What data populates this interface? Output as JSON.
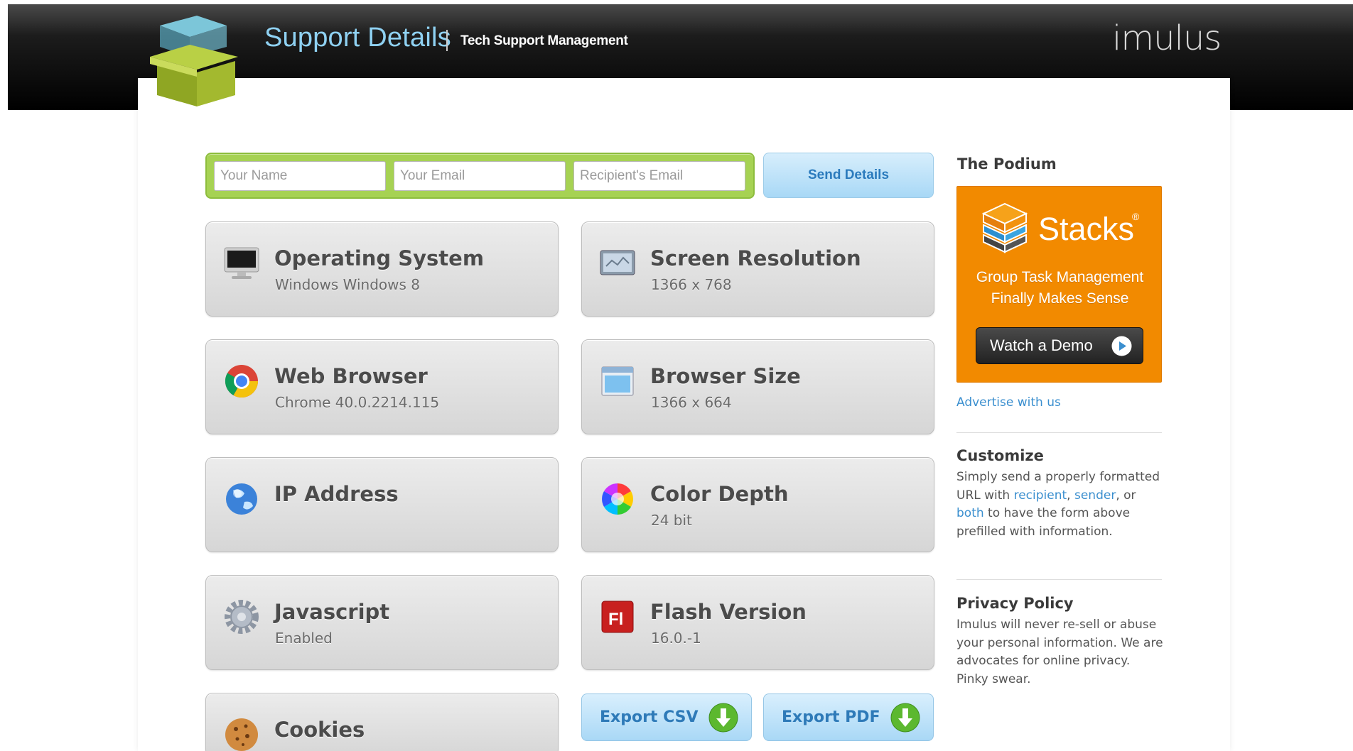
{
  "header": {
    "title": "Support Details",
    "subtitle": "Tech Support Management",
    "brand": "imulus"
  },
  "form": {
    "name_placeholder": "Your Name",
    "email_placeholder": "Your Email",
    "recipient_placeholder": "Recipient's Email",
    "send_label": "Send Details"
  },
  "tiles": {
    "os": {
      "label": "Operating System",
      "value": "Windows Windows 8"
    },
    "resolution": {
      "label": "Screen Resolution",
      "value": "1366 x 768"
    },
    "browser": {
      "label": "Web Browser",
      "value": "Chrome 40.0.2214.115"
    },
    "browser_size": {
      "label": "Browser Size",
      "value": "1366 x 664"
    },
    "ip": {
      "label": "IP Address",
      "value": ""
    },
    "color_depth": {
      "label": "Color Depth",
      "value": "24 bit"
    },
    "javascript": {
      "label": "Javascript",
      "value": "Enabled"
    },
    "flash": {
      "label": "Flash Version",
      "value": "16.0.-1"
    },
    "cookies": {
      "label": "Cookies",
      "value": ""
    }
  },
  "export": {
    "csv_label": "Export CSV",
    "pdf_label": "Export PDF"
  },
  "sidebar": {
    "podium_heading": "The Podium",
    "ad": {
      "name": "Stacks",
      "reg": "®",
      "line1": "Group Task Management",
      "line2": "Finally Makes Sense",
      "demo_label": "Watch a Demo"
    },
    "advertise_link": "Advertise with us",
    "customize": {
      "heading": "Customize",
      "text_1": "Simply send a properly formatted URL with ",
      "link_recipient": "recipient",
      "text_2": ", ",
      "link_sender": "sender",
      "text_3": ", or ",
      "link_both": "both",
      "text_4": " to have the form above prefilled with information."
    },
    "privacy": {
      "heading": "Privacy Policy",
      "text": "Imulus will never re-sell or abuse your personal information. We are advocates for online privacy. Pinky swear."
    }
  },
  "colors": {
    "form_green": "#a6d253",
    "title_blue": "#8fd1f2",
    "ad_orange": "#f28a00",
    "link_blue": "#3b8fcf"
  },
  "icons": {
    "os": "monitor-icon",
    "resolution": "screen-icon",
    "browser": "chrome-icon",
    "browser_size": "window-icon",
    "ip": "globe-icon",
    "color_depth": "color-wheel-icon",
    "javascript": "gear-icon",
    "flash": "flash-icon",
    "cookies": "cookie-icon"
  }
}
